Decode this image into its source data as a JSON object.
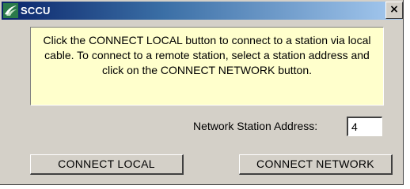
{
  "window": {
    "title": "SCCU",
    "app_icon": "sccu-app-icon",
    "close_label": "×"
  },
  "info": {
    "text": "Click the CONNECT LOCAL button  to connect to a station via local cable. To connect to a remote station, select a station address and click on the CONNECT NETWORK button."
  },
  "station": {
    "label": "Network Station Address:",
    "value": "4"
  },
  "buttons": {
    "connect_local": "CONNECT LOCAL",
    "connect_network": "CONNECT NETWORK"
  },
  "colors": {
    "title_bar_start": "#0a246a",
    "title_bar_end": "#a6caf0",
    "info_background": "#ffffcc",
    "dialog_face": "#d4d0c8"
  }
}
